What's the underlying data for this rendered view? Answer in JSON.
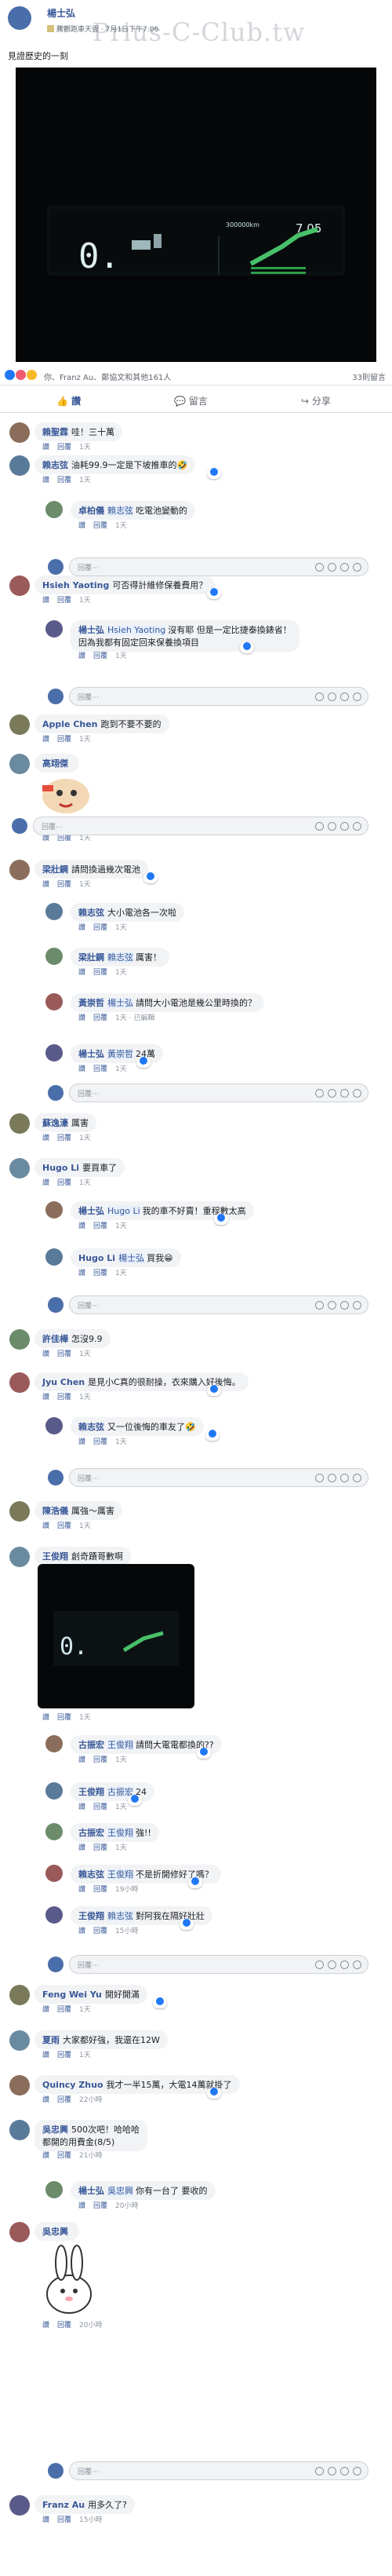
{
  "watermark": "Prius-C-Club.tw",
  "post": {
    "author": "楊士弘",
    "group": "騰觀跑車天雲",
    "time": "7月1日下午7:06",
    "text": "見證歷史的一刻",
    "dash": {
      "left": "0.",
      "odo": "300000km",
      "right": "7.05"
    }
  },
  "reactions": {
    "summary": "你、Franz Au、鄭協文和其他161人",
    "comments": "33則留言"
  },
  "actions": {
    "like": "讚",
    "comment": "留言",
    "share": "分享"
  },
  "reply_placeholder": "回覆⋯",
  "like_label": "讚",
  "reply_label": "回覆",
  "comments": [
    {
      "author": "賴聖霖",
      "tag": "",
      "text": "哇！三十萬",
      "meta": "1天"
    },
    {
      "author": "賴志弦",
      "tag": "",
      "text": "油耗99.9一定是下坡推車的🤣",
      "meta": "1天"
    },
    {
      "author": "卓柏儀",
      "tag": "賴志弦",
      "text": "吃電池變動的",
      "meta": "1天"
    },
    {
      "author": "Hsieh Yaoting",
      "tag": "",
      "text": "可否得計維修保養費用？",
      "meta": "1天"
    },
    {
      "author": "楊士弘",
      "tag": "Hsieh Yaoting",
      "text": "沒有耶 但是一定比捷泰換錶省！",
      "text2": "因為我都有固定回來保養換項目",
      "meta": "1天"
    },
    {
      "author": "Apple Chen",
      "tag": "",
      "text": "跑到不要不要的",
      "meta": "1天"
    },
    {
      "author": "高翊傑",
      "tag": "",
      "text": "",
      "meta": "1天"
    },
    {
      "author": "梁壯鋼",
      "tag": "",
      "text": "請問換過幾次電池",
      "meta": "1天"
    },
    {
      "author": "賴志弦",
      "tag": "",
      "text": "大小電池各一次啦",
      "meta": "1天"
    },
    {
      "author": "梁壯鋼",
      "tag": "賴志弦",
      "text": "厲害！",
      "meta": "1天"
    },
    {
      "author": "黃崇哲",
      "tag": "楊士弘",
      "text": "請問大小電池是幾公里時換的？",
      "meta": "1天 · 已編輯"
    },
    {
      "author": "楊士弘",
      "tag": "黃崇哲",
      "text": "24萬",
      "meta": "1天"
    },
    {
      "author": "蘇逸濠",
      "tag": "",
      "text": "厲害",
      "meta": "1天"
    },
    {
      "author": "Hugo Li",
      "tag": "",
      "text": "要買車了",
      "meta": "1天"
    },
    {
      "author": "楊士弘",
      "tag": "Hugo Li",
      "text": "我的車不好賣！重程數太高",
      "meta": "1天"
    },
    {
      "author": "Hugo Li",
      "tag": "楊士弘",
      "text": "買我😁",
      "meta": "1天"
    },
    {
      "author": "許佳樺",
      "tag": "",
      "text": "怎沒9.9",
      "meta": "1天"
    },
    {
      "author": "Jyu Chen",
      "tag": "",
      "text": "是見小C真的很耐操，衣來購入好後悔。",
      "meta": "1天"
    },
    {
      "author": "賴志弦",
      "tag": "",
      "text": "又一位後悔的車友了🤣",
      "meta": "1天"
    },
    {
      "author": "陳浩儀",
      "tag": "",
      "text": "厲強〜厲害",
      "meta": "1天"
    },
    {
      "author": "王俊翔",
      "tag": "",
      "text": "創奇蹟哥數啊",
      "meta": "1天"
    },
    {
      "author": "古振宏",
      "tag": "王俊翔",
      "text": "請問大電電都換的??",
      "meta": "1天"
    },
    {
      "author": "王俊翔",
      "tag": "古振宏",
      "text": "24",
      "meta": "1天"
    },
    {
      "author": "古振宏",
      "tag": "王俊翔",
      "text": "強!!",
      "meta": "1天"
    },
    {
      "author": "賴志弦",
      "tag": "王俊翔",
      "text": "不是折開修好了嗎？",
      "meta": "19小時"
    },
    {
      "author": "王俊翔",
      "tag": "賴志弦",
      "text": "對阿我在隔好壯壯",
      "meta": "15小時"
    },
    {
      "author": "Feng Wei Yu",
      "tag": "",
      "text": "開好開滿",
      "meta": "1天"
    },
    {
      "author": "夏雨",
      "tag": "",
      "text": "大家都好強，我還在12W",
      "meta": "1天"
    },
    {
      "author": "Quincy Zhuo",
      "tag": "",
      "text": "我才一半15萬，大電14萬就掛了",
      "meta": "22小時"
    },
    {
      "author": "吳忠興",
      "tag": "",
      "text": "500次吧！哈哈哈",
      "text2": "都開的用費金(8/5)",
      "meta": "21小時"
    },
    {
      "author": "楊士弘",
      "tag": "吳忠興",
      "text": "你有一台了 要收的",
      "meta": "20小時"
    },
    {
      "author": "吳忠興",
      "tag": "",
      "text": "",
      "meta": "20小時"
    },
    {
      "author": "Franz Au",
      "tag": "",
      "text": "用多久了?",
      "meta": "15小時"
    }
  ]
}
